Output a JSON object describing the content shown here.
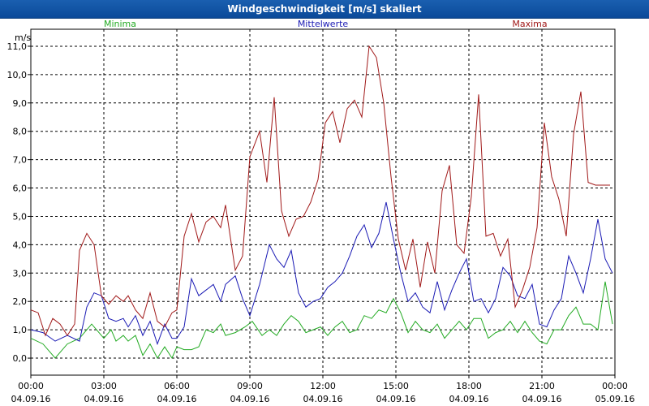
{
  "window": {
    "title": "Windgeschwindigkeit [m/s] skaliert"
  },
  "chart_data": {
    "type": "line",
    "title": "Windgeschwindigkeit [m/s] skaliert",
    "ylabel": "m/s",
    "xlabel": "",
    "ylim": [
      -0.6,
      11.6
    ],
    "xlim_hours": [
      0,
      24
    ],
    "grid": true,
    "legend": "top",
    "yticks": [
      "0,0",
      "1,0",
      "2,0",
      "3,0",
      "4,0",
      "5,0",
      "6,0",
      "7,0",
      "8,0",
      "9,0",
      "10,0",
      "11,0"
    ],
    "xticks": [
      {
        "time": "00:00",
        "date": "04.09.16"
      },
      {
        "time": "03:00",
        "date": "04.09.16"
      },
      {
        "time": "06:00",
        "date": "04.09.16"
      },
      {
        "time": "09:00",
        "date": "04.09.16"
      },
      {
        "time": "12:00",
        "date": "04.09.16"
      },
      {
        "time": "15:00",
        "date": "04.09.16"
      },
      {
        "time": "18:00",
        "date": "04.09.16"
      },
      {
        "time": "21:00",
        "date": "04.09.16"
      },
      {
        "time": "00:00",
        "date": "05.09.16"
      }
    ],
    "series": [
      {
        "name": "Minima",
        "color": "#22aa22",
        "x": [
          0,
          0.5,
          1,
          1.5,
          2,
          2.5,
          2.8,
          3,
          3.3,
          3.5,
          3.8,
          4,
          4.3,
          4.6,
          4.9,
          5.2,
          5.5,
          5.8,
          6,
          6.3,
          6.6,
          6.9,
          7.2,
          7.5,
          7.8,
          8,
          8.4,
          8.8,
          9.1,
          9.5,
          9.8,
          10.1,
          10.4,
          10.7,
          11,
          11.3,
          11.6,
          11.9,
          12.2,
          12.5,
          12.8,
          13.1,
          13.4,
          13.7,
          14,
          14.3,
          14.6,
          14.9,
          15.2,
          15.5,
          15.8,
          16.1,
          16.4,
          16.7,
          17,
          17.3,
          17.6,
          17.9,
          18.2,
          18.5,
          18.8,
          19.1,
          19.4,
          19.7,
          20,
          20.3,
          20.6,
          20.9,
          21.2,
          21.5,
          21.8,
          22.1,
          22.4,
          22.7,
          23,
          23.3,
          23.6,
          23.9
        ],
        "values": [
          0.7,
          0.5,
          0.0,
          0.5,
          0.7,
          1.2,
          0.9,
          0.7,
          1.0,
          0.6,
          0.8,
          0.6,
          0.8,
          0.1,
          0.5,
          0.0,
          0.4,
          0.0,
          0.4,
          0.3,
          0.3,
          0.4,
          1.0,
          0.9,
          1.2,
          0.8,
          0.9,
          1.1,
          1.3,
          0.8,
          1.0,
          0.8,
          1.2,
          1.5,
          1.3,
          0.9,
          1.0,
          1.1,
          0.8,
          1.1,
          1.3,
          0.9,
          1.0,
          1.5,
          1.4,
          1.7,
          1.6,
          2.1,
          1.6,
          0.9,
          1.3,
          1.0,
          0.9,
          1.2,
          0.7,
          1.0,
          1.3,
          1.0,
          1.4,
          1.4,
          0.7,
          0.9,
          1.0,
          1.3,
          0.9,
          1.3,
          0.9,
          0.6,
          0.5,
          1.0,
          1.0,
          1.5,
          1.8,
          1.2,
          1.2,
          1.0,
          2.7,
          1.2
        ],
        "labelpos": "left"
      },
      {
        "name": "Mittelwerte",
        "color": "#1a1ab4",
        "x": [
          0,
          0.5,
          1,
          1.5,
          2,
          2.3,
          2.6,
          2.9,
          3.2,
          3.5,
          3.8,
          4,
          4.3,
          4.6,
          4.9,
          5.2,
          5.5,
          5.8,
          6,
          6.3,
          6.6,
          6.9,
          7.2,
          7.5,
          7.8,
          8,
          8.4,
          8.7,
          9,
          9.4,
          9.8,
          10.1,
          10.4,
          10.7,
          11,
          11.3,
          11.6,
          11.9,
          12.2,
          12.5,
          12.8,
          13.1,
          13.4,
          13.7,
          14,
          14.3,
          14.6,
          14.9,
          15.2,
          15.5,
          15.8,
          16.1,
          16.4,
          16.7,
          17,
          17.3,
          17.6,
          17.9,
          18.2,
          18.5,
          18.8,
          19.1,
          19.4,
          19.7,
          20,
          20.3,
          20.6,
          20.9,
          21.2,
          21.5,
          21.8,
          22.1,
          22.4,
          22.7,
          23,
          23.3,
          23.6,
          23.9
        ],
        "values": [
          1.0,
          0.9,
          0.6,
          0.8,
          0.6,
          1.8,
          2.3,
          2.2,
          1.4,
          1.3,
          1.4,
          1.1,
          1.5,
          0.8,
          1.3,
          0.5,
          1.2,
          0.7,
          0.7,
          1.1,
          2.8,
          2.2,
          2.4,
          2.6,
          2.0,
          2.6,
          2.9,
          2.1,
          1.5,
          2.6,
          4.0,
          3.5,
          3.2,
          3.8,
          2.3,
          1.8,
          2.0,
          2.1,
          2.5,
          2.7,
          3.0,
          3.6,
          4.3,
          4.7,
          3.9,
          4.4,
          5.5,
          4.2,
          3.0,
          2.0,
          2.3,
          1.8,
          1.6,
          2.7,
          1.7,
          2.4,
          3.0,
          3.5,
          2.0,
          2.1,
          1.6,
          2.1,
          3.2,
          2.9,
          2.2,
          2.1,
          2.6,
          1.2,
          1.1,
          1.7,
          2.1,
          3.6,
          3.0,
          2.3,
          3.5,
          4.9,
          3.5,
          3.0
        ],
        "labelpos": "center"
      },
      {
        "name": "Maxima",
        "color": "#a01818",
        "x": [
          0,
          0.3,
          0.6,
          0.9,
          1.2,
          1.5,
          1.8,
          2,
          2.3,
          2.6,
          2.9,
          3.2,
          3.5,
          3.8,
          4,
          4.3,
          4.6,
          4.9,
          5.2,
          5.5,
          5.8,
          6,
          6.3,
          6.6,
          6.9,
          7.2,
          7.5,
          7.8,
          8,
          8.4,
          8.7,
          9,
          9.4,
          9.7,
          10,
          10.3,
          10.6,
          10.9,
          11.2,
          11.5,
          11.8,
          12.1,
          12.4,
          12.7,
          13,
          13.3,
          13.6,
          13.9,
          14.2,
          14.5,
          14.8,
          15.1,
          15.4,
          15.7,
          16,
          16.3,
          16.6,
          16.9,
          17.2,
          17.5,
          17.8,
          18.1,
          18.4,
          18.7,
          19,
          19.3,
          19.6,
          19.9,
          20.2,
          20.5,
          20.8,
          21.1,
          21.4,
          21.7,
          22,
          22.3,
          22.6,
          22.9,
          23.2,
          23.5,
          23.8
        ],
        "values": [
          1.7,
          1.6,
          0.8,
          1.4,
          1.2,
          0.8,
          1.2,
          3.8,
          4.4,
          4.0,
          2.2,
          1.9,
          2.2,
          2.0,
          2.2,
          1.7,
          1.4,
          2.3,
          1.3,
          1.1,
          1.6,
          1.7,
          4.3,
          5.1,
          4.1,
          4.8,
          5.0,
          4.6,
          5.4,
          3.1,
          3.6,
          7.1,
          8.0,
          6.2,
          9.2,
          5.2,
          4.3,
          4.9,
          5.0,
          5.5,
          6.3,
          8.3,
          8.7,
          7.6,
          8.8,
          9.1,
          8.5,
          11.0,
          10.6,
          9.0,
          6.4,
          4.2,
          3.1,
          4.2,
          2.5,
          4.1,
          3.0,
          5.9,
          6.8,
          4.0,
          3.7,
          5.7,
          9.3,
          4.3,
          4.4,
          3.6,
          4.2,
          1.8,
          2.4,
          3.2,
          4.6,
          8.3,
          6.4,
          5.6,
          4.3,
          7.9,
          9.4,
          6.2,
          6.1,
          6.1,
          6.1
        ],
        "labelpos": "right"
      }
    ]
  }
}
